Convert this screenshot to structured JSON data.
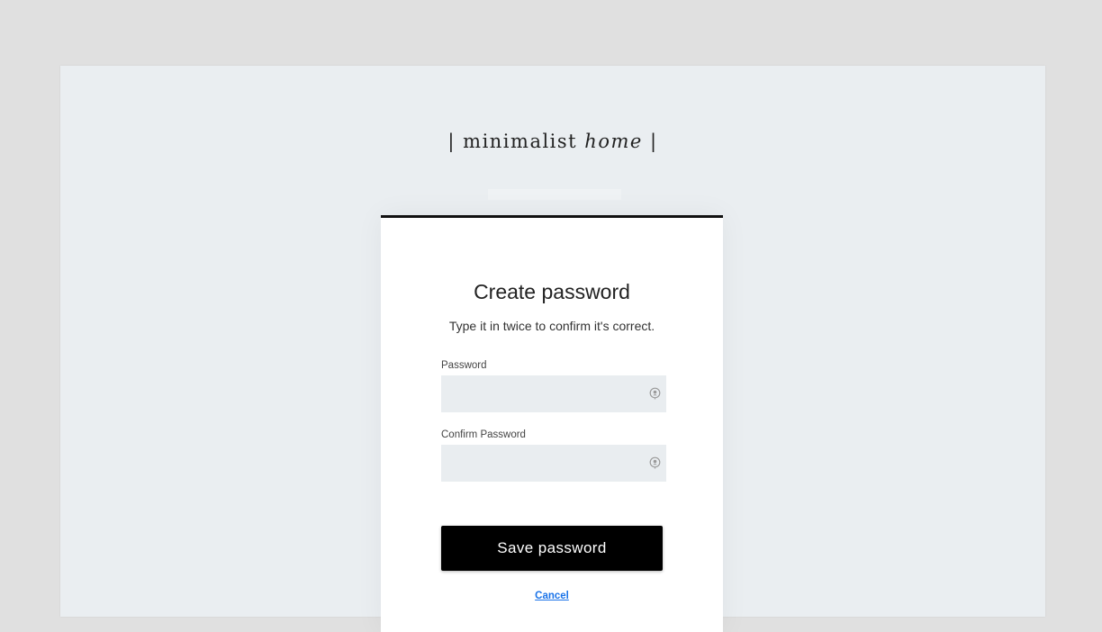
{
  "brand": {
    "logo_prefix": "| minimalist ",
    "logo_italic": "home",
    "logo_suffix": " |"
  },
  "card": {
    "title": "Create password",
    "subtitle": "Type it in twice to confirm it's correct."
  },
  "fields": {
    "password_label": "Password",
    "password_value": "",
    "password_icon": "eye-lock-icon",
    "confirm_label": "Confirm Password",
    "confirm_value": "",
    "confirm_icon": "eye-lock-icon"
  },
  "actions": {
    "save_label": "Save password",
    "cancel_label": "Cancel"
  },
  "colors": {
    "background": "#e0e0e0",
    "page": "#eaeef1",
    "card": "#ffffff",
    "input": "#e9edf0",
    "button": "#000000",
    "link": "#1a73e8"
  }
}
